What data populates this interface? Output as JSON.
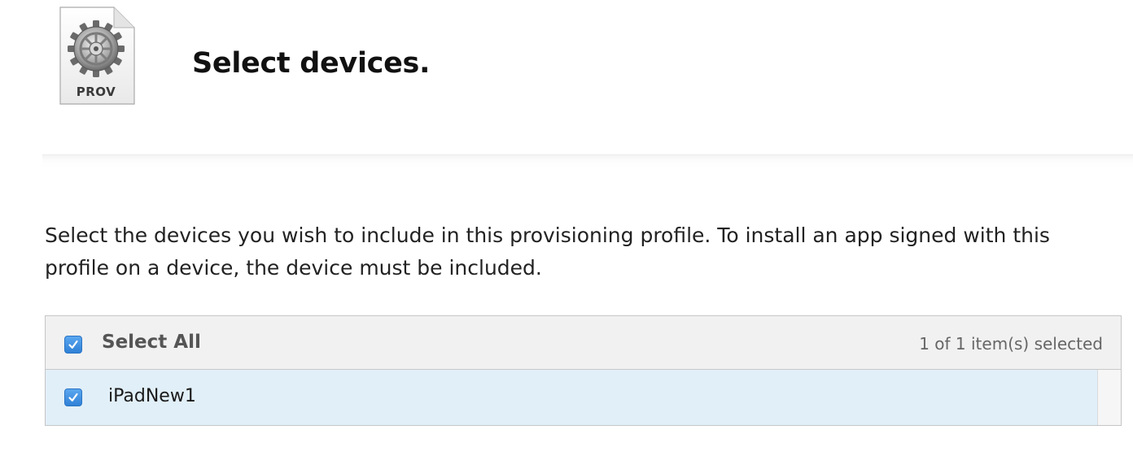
{
  "header": {
    "icon_label": "PROV",
    "title": "Select devices."
  },
  "description": "Select the devices you wish to include in this provisioning profile. To install an app signed with this profile on a device, the device must be included.",
  "device_table": {
    "select_all_label": "Select All",
    "select_all_checked": true,
    "selection_count": "1 of 1 item(s) selected",
    "rows": [
      {
        "name": "iPadNew1",
        "checked": true
      }
    ]
  },
  "colors": {
    "checkbox_accent": "#3d8fe0",
    "selected_row_bg": "#e1eff8",
    "header_bg": "#f1f1f1"
  },
  "icons": {
    "file_icon": "provisioning-profile-file-icon",
    "gear": "gear-icon",
    "checkmark": "checkmark-icon"
  }
}
